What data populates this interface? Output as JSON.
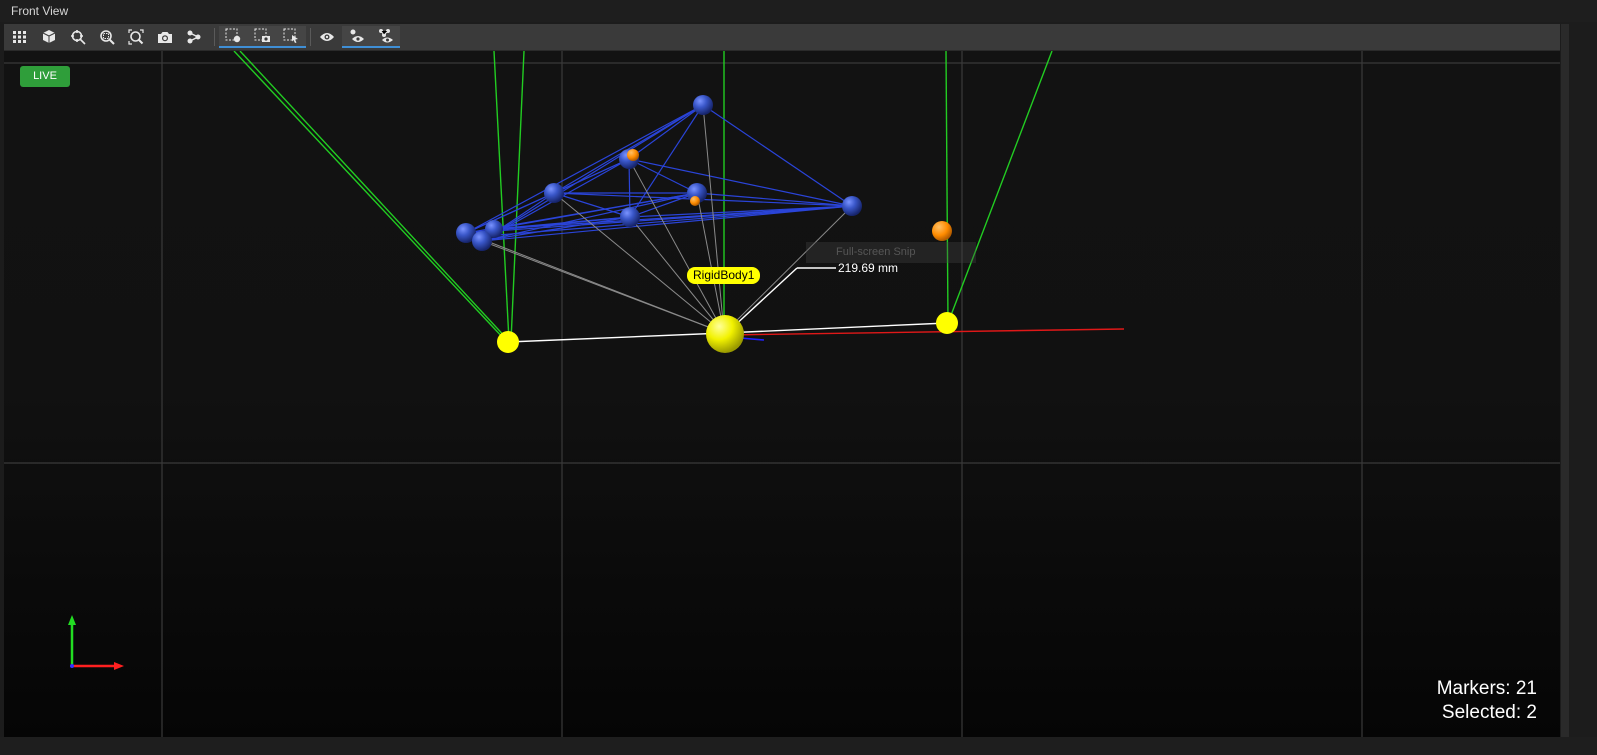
{
  "window": {
    "title": "Front View"
  },
  "toolbar": {
    "groups": [
      [
        "grid-icon",
        "cube-icon",
        "zoom-target-icon",
        "zoom-in-icon",
        "zoom-fit-icon",
        "camera-icon",
        "skeleton-icon"
      ],
      [
        "select-marker-icon",
        "select-camera-icon",
        "select-asset-icon"
      ],
      [
        "visibility-icon",
        "marker-visibility-icon",
        "asset-visibility-icon"
      ]
    ],
    "active": [
      "select-marker-icon",
      "select-camera-icon",
      "select-asset-icon",
      "marker-visibility-icon",
      "asset-visibility-icon"
    ]
  },
  "viewport": {
    "live_label": "LIVE",
    "rigid_body_label": "RigidBody1",
    "measurement": "219.69 mm",
    "ghost_tooltip": "Full-screen Snip",
    "stats": {
      "markers_label": "Markers: 21",
      "selected_label": "Selected: 2"
    },
    "colors": {
      "live": "#2f9e3a",
      "rigid_body": "#ffff00",
      "markers": "#3a57c9",
      "unlabeled": "#ff8c00",
      "camera_rays": "#22cc22",
      "x_axis": "#ff2020",
      "y_axis": "#22dd22"
    }
  }
}
